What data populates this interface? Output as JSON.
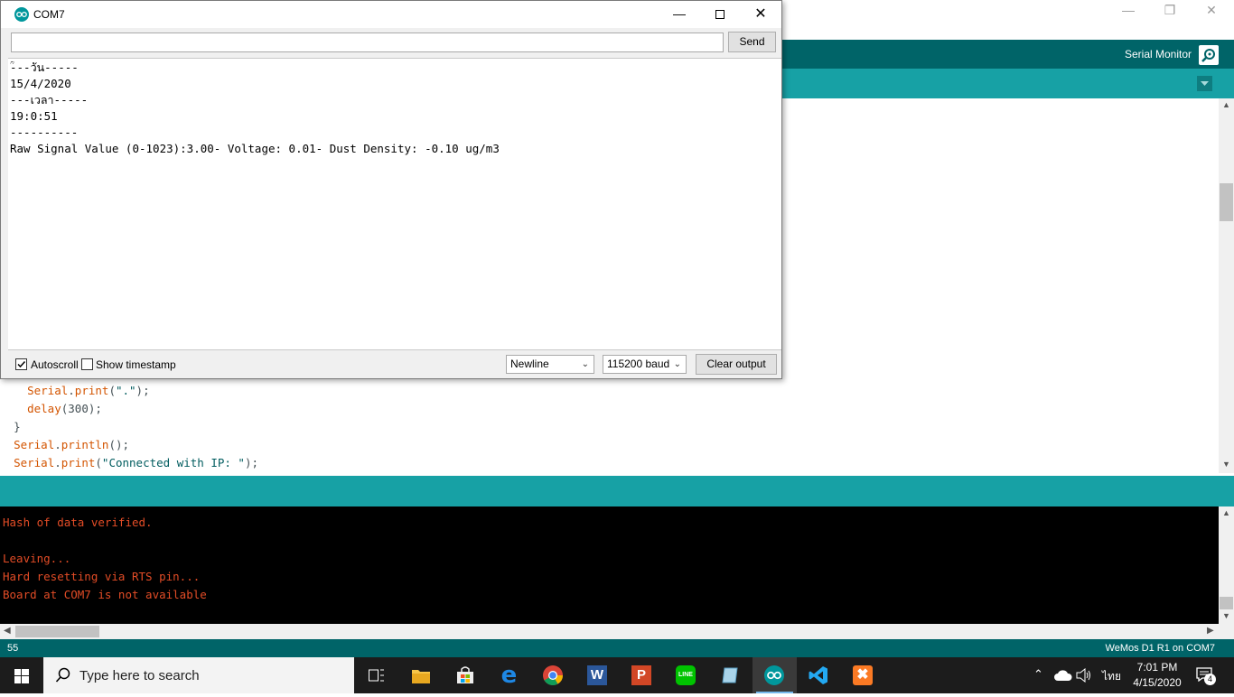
{
  "serial_monitor": {
    "title": "COM7",
    "input_value": "",
    "send_label": "Send",
    "output_lines": [
      "ؒ---วัน-----",
      "15/4/2020",
      "---เวลา-----",
      "19:0:51",
      "----------",
      "Raw Signal Value (0-1023):3.00- Voltage: 0.01- Dust Density: -0.10 ug/m3"
    ],
    "autoscroll_label": "Autoscroll",
    "autoscroll_checked": true,
    "timestamp_label": "Show timestamp",
    "timestamp_checked": false,
    "line_ending": "Newline",
    "baud_rate": "115200 baud",
    "clear_label": "Clear output"
  },
  "ide": {
    "serial_monitor_label": "Serial Monitor",
    "code_lines": [
      {
        "indent": "    ",
        "obj": "Serial",
        "fn": "print",
        "arg": "\".\"",
        "end": ";"
      },
      {
        "indent": "    ",
        "obj": "",
        "fn": "delay",
        "arg": "300",
        "end": ";"
      },
      {
        "indent": "  ",
        "obj": "",
        "fn": "",
        "arg": "",
        "end": "}"
      },
      {
        "indent": "  ",
        "obj": "Serial",
        "fn": "println",
        "arg": "",
        "end": ";"
      },
      {
        "indent": "  ",
        "obj": "Serial",
        "fn": "print",
        "arg": "\"Connected with IP: \"",
        "end": ";"
      }
    ],
    "console_lines": [
      "Hash of data verified.",
      "",
      "Leaving...",
      "Hard resetting via RTS pin...",
      "Board at COM7 is not available"
    ],
    "line_number": "55",
    "board_status": "WeMos D1 R1 on COM7"
  },
  "taskbar": {
    "search_placeholder": "Type here to search",
    "time": "7:01 PM",
    "date": "4/15/2020",
    "language": "ไทย",
    "notification_count": "4"
  },
  "colors": {
    "arduino_dark": "#006468",
    "arduino_teal": "#17a1a5",
    "console_text": "#e34c26"
  }
}
